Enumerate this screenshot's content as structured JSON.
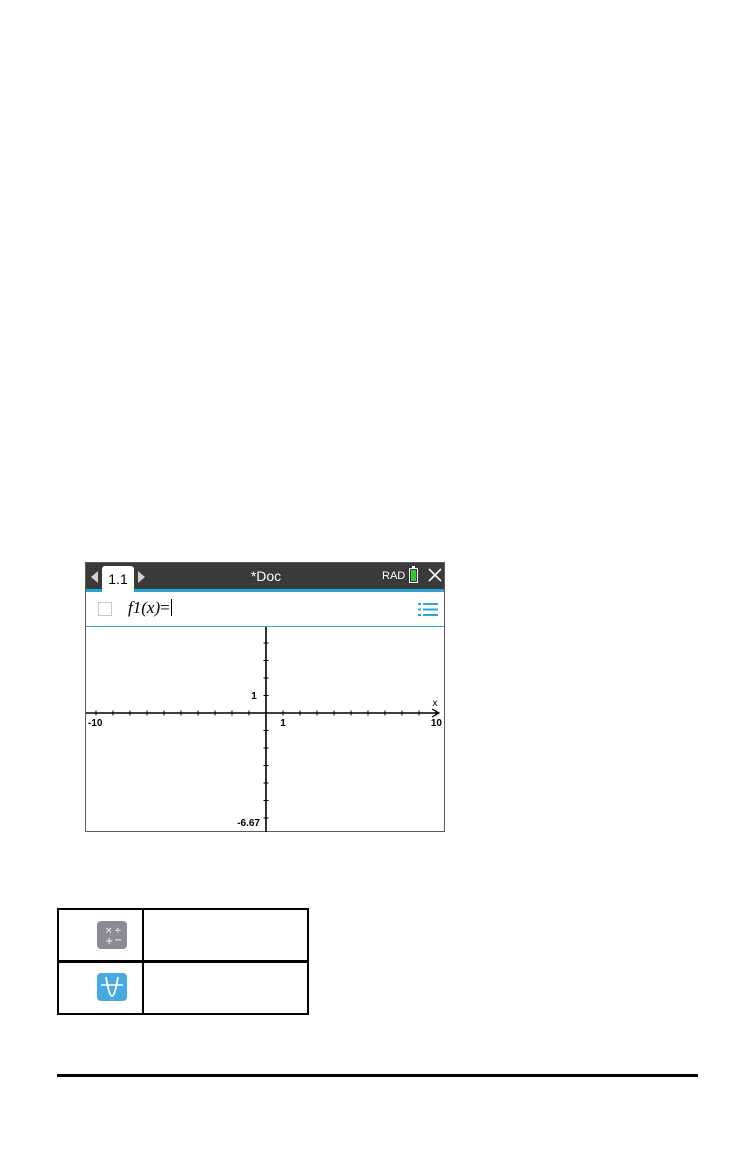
{
  "window": {
    "tab_label": "1.1",
    "doc_title": "*Doc",
    "angle_mode": "RAD"
  },
  "entry_line": {
    "function_name": "f1",
    "variable": "x",
    "equals": "="
  },
  "graph": {
    "x_axis_label": "x",
    "x_min_label": "-10",
    "x_max_label": "10",
    "x_unit_label": "1",
    "y_unit_label": "1",
    "y_min_label": "-6.67",
    "x_range": [
      -10,
      10
    ],
    "y_range": [
      -6.67,
      6.67
    ]
  },
  "icons": {
    "calculator_app": "calculator-app-icon",
    "graphs_app": "graphs-app-icon"
  },
  "colors": {
    "tab_bar": "#3a3a3a",
    "accent": "#2aa7d6",
    "battery": "#35c43a",
    "calc_icon_bg": "#8b8b96",
    "graph_icon_bg": "#4aa9e0"
  }
}
